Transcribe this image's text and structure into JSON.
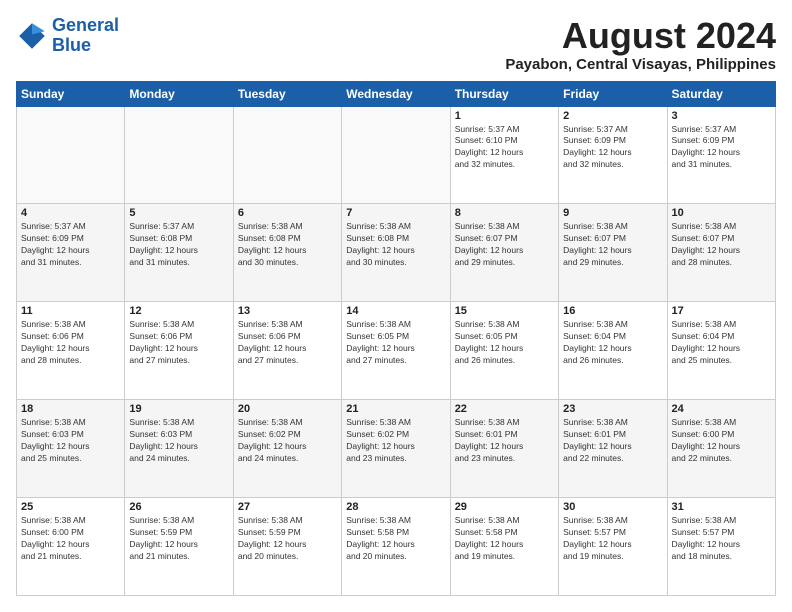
{
  "header": {
    "logo_line1": "General",
    "logo_line2": "Blue",
    "main_title": "August 2024",
    "subtitle": "Payabon, Central Visayas, Philippines"
  },
  "days_of_week": [
    "Sunday",
    "Monday",
    "Tuesday",
    "Wednesday",
    "Thursday",
    "Friday",
    "Saturday"
  ],
  "weeks": [
    [
      {
        "day": "",
        "info": ""
      },
      {
        "day": "",
        "info": ""
      },
      {
        "day": "",
        "info": ""
      },
      {
        "day": "",
        "info": ""
      },
      {
        "day": "1",
        "info": "Sunrise: 5:37 AM\nSunset: 6:10 PM\nDaylight: 12 hours\nand 32 minutes."
      },
      {
        "day": "2",
        "info": "Sunrise: 5:37 AM\nSunset: 6:09 PM\nDaylight: 12 hours\nand 32 minutes."
      },
      {
        "day": "3",
        "info": "Sunrise: 5:37 AM\nSunset: 6:09 PM\nDaylight: 12 hours\nand 31 minutes."
      }
    ],
    [
      {
        "day": "4",
        "info": "Sunrise: 5:37 AM\nSunset: 6:09 PM\nDaylight: 12 hours\nand 31 minutes."
      },
      {
        "day": "5",
        "info": "Sunrise: 5:37 AM\nSunset: 6:08 PM\nDaylight: 12 hours\nand 31 minutes."
      },
      {
        "day": "6",
        "info": "Sunrise: 5:38 AM\nSunset: 6:08 PM\nDaylight: 12 hours\nand 30 minutes."
      },
      {
        "day": "7",
        "info": "Sunrise: 5:38 AM\nSunset: 6:08 PM\nDaylight: 12 hours\nand 30 minutes."
      },
      {
        "day": "8",
        "info": "Sunrise: 5:38 AM\nSunset: 6:07 PM\nDaylight: 12 hours\nand 29 minutes."
      },
      {
        "day": "9",
        "info": "Sunrise: 5:38 AM\nSunset: 6:07 PM\nDaylight: 12 hours\nand 29 minutes."
      },
      {
        "day": "10",
        "info": "Sunrise: 5:38 AM\nSunset: 6:07 PM\nDaylight: 12 hours\nand 28 minutes."
      }
    ],
    [
      {
        "day": "11",
        "info": "Sunrise: 5:38 AM\nSunset: 6:06 PM\nDaylight: 12 hours\nand 28 minutes."
      },
      {
        "day": "12",
        "info": "Sunrise: 5:38 AM\nSunset: 6:06 PM\nDaylight: 12 hours\nand 27 minutes."
      },
      {
        "day": "13",
        "info": "Sunrise: 5:38 AM\nSunset: 6:06 PM\nDaylight: 12 hours\nand 27 minutes."
      },
      {
        "day": "14",
        "info": "Sunrise: 5:38 AM\nSunset: 6:05 PM\nDaylight: 12 hours\nand 27 minutes."
      },
      {
        "day": "15",
        "info": "Sunrise: 5:38 AM\nSunset: 6:05 PM\nDaylight: 12 hours\nand 26 minutes."
      },
      {
        "day": "16",
        "info": "Sunrise: 5:38 AM\nSunset: 6:04 PM\nDaylight: 12 hours\nand 26 minutes."
      },
      {
        "day": "17",
        "info": "Sunrise: 5:38 AM\nSunset: 6:04 PM\nDaylight: 12 hours\nand 25 minutes."
      }
    ],
    [
      {
        "day": "18",
        "info": "Sunrise: 5:38 AM\nSunset: 6:03 PM\nDaylight: 12 hours\nand 25 minutes."
      },
      {
        "day": "19",
        "info": "Sunrise: 5:38 AM\nSunset: 6:03 PM\nDaylight: 12 hours\nand 24 minutes."
      },
      {
        "day": "20",
        "info": "Sunrise: 5:38 AM\nSunset: 6:02 PM\nDaylight: 12 hours\nand 24 minutes."
      },
      {
        "day": "21",
        "info": "Sunrise: 5:38 AM\nSunset: 6:02 PM\nDaylight: 12 hours\nand 23 minutes."
      },
      {
        "day": "22",
        "info": "Sunrise: 5:38 AM\nSunset: 6:01 PM\nDaylight: 12 hours\nand 23 minutes."
      },
      {
        "day": "23",
        "info": "Sunrise: 5:38 AM\nSunset: 6:01 PM\nDaylight: 12 hours\nand 22 minutes."
      },
      {
        "day": "24",
        "info": "Sunrise: 5:38 AM\nSunset: 6:00 PM\nDaylight: 12 hours\nand 22 minutes."
      }
    ],
    [
      {
        "day": "25",
        "info": "Sunrise: 5:38 AM\nSunset: 6:00 PM\nDaylight: 12 hours\nand 21 minutes."
      },
      {
        "day": "26",
        "info": "Sunrise: 5:38 AM\nSunset: 5:59 PM\nDaylight: 12 hours\nand 21 minutes."
      },
      {
        "day": "27",
        "info": "Sunrise: 5:38 AM\nSunset: 5:59 PM\nDaylight: 12 hours\nand 20 minutes."
      },
      {
        "day": "28",
        "info": "Sunrise: 5:38 AM\nSunset: 5:58 PM\nDaylight: 12 hours\nand 20 minutes."
      },
      {
        "day": "29",
        "info": "Sunrise: 5:38 AM\nSunset: 5:58 PM\nDaylight: 12 hours\nand 19 minutes."
      },
      {
        "day": "30",
        "info": "Sunrise: 5:38 AM\nSunset: 5:57 PM\nDaylight: 12 hours\nand 19 minutes."
      },
      {
        "day": "31",
        "info": "Sunrise: 5:38 AM\nSunset: 5:57 PM\nDaylight: 12 hours\nand 18 minutes."
      }
    ]
  ]
}
